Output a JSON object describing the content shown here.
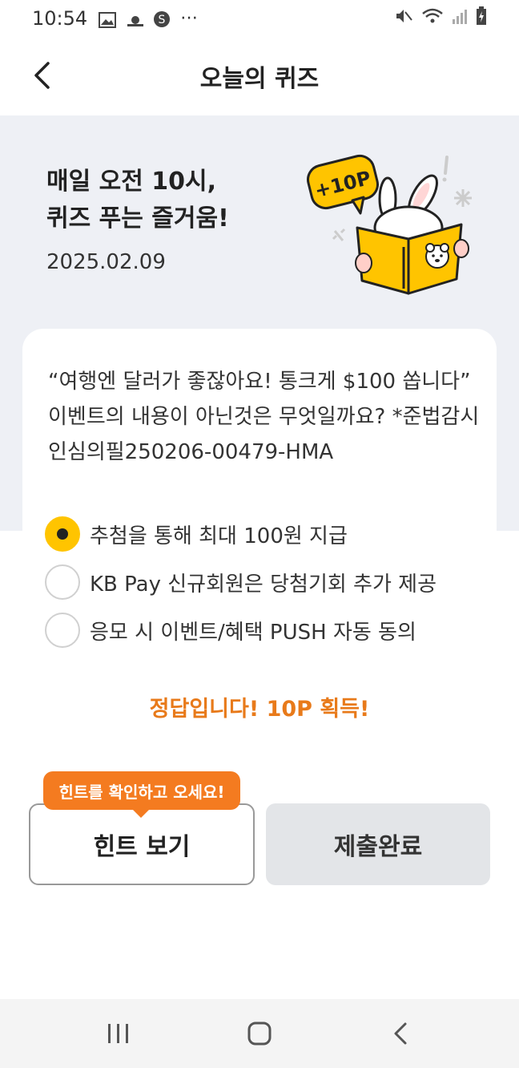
{
  "status_bar": {
    "time": "10:54"
  },
  "header": {
    "title": "오늘의 퀴즈"
  },
  "hero": {
    "title_line1": "매일 오전 10시,",
    "title_line2": "퀴즈 푸는 즐거움!",
    "date": "2025.02.09",
    "badge": "+10P"
  },
  "quiz": {
    "question": "“여행엔 달러가 좋잖아요! 통크게 $100 쏩니다” 이벤트의 내용이 아닌것은 무엇일까요? *준법감시인심의필250206-00479-HMA",
    "options": [
      {
        "label": "추첨을 통해 최대 100원 지급",
        "selected": true
      },
      {
        "label": "KB Pay 신규회원은 당첨기회 추가 제공",
        "selected": false
      },
      {
        "label": "응모 시 이벤트/혜택 PUSH 자동 동의",
        "selected": false
      }
    ],
    "result": "정답입니다! 10P 획득!"
  },
  "actions": {
    "tooltip": "힌트를 확인하고 오세요!",
    "hint_label": "힌트 보기",
    "submit_label": "제출완료"
  },
  "colors": {
    "accent": "#ffc400",
    "result": "#e87a1a",
    "tooltip": "#f47b20"
  },
  "icons": [
    "back-icon",
    "gallery-icon",
    "weather-icon",
    "s-icon",
    "more-icon",
    "mute-icon",
    "wifi-icon",
    "signal-icon",
    "battery-icon",
    "recents-icon",
    "home-icon",
    "nav-back-icon"
  ]
}
